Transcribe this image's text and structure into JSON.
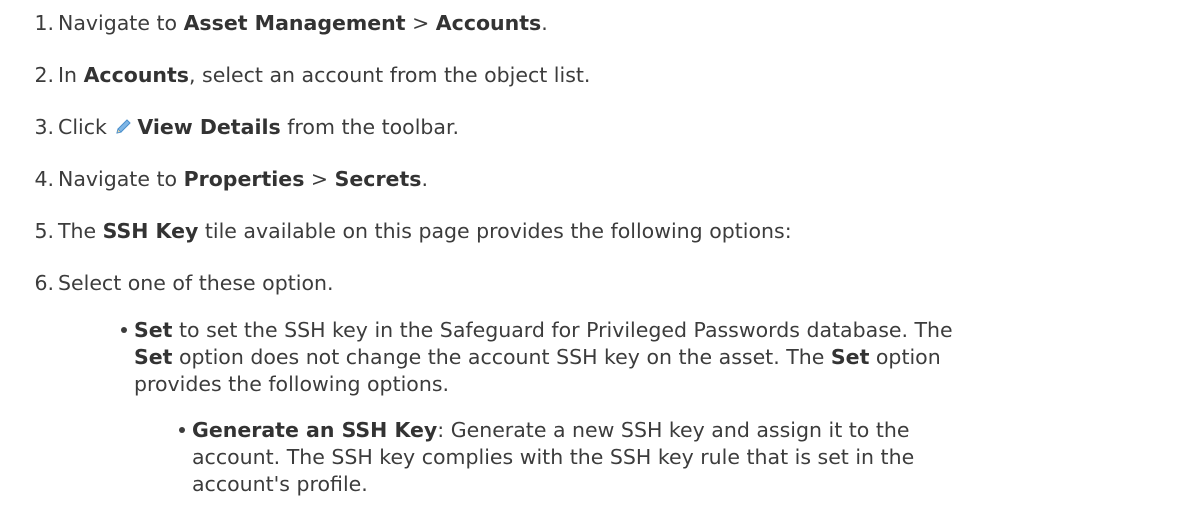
{
  "steps": [
    {
      "num": "1.",
      "a": "Navigate to ",
      "b1": "Asset Management",
      "c": " > ",
      "b2": "Accounts",
      "d": "."
    },
    {
      "num": "2.",
      "a": "In ",
      "b1": "Accounts",
      "c": ", select an account from the object list."
    },
    {
      "num": "3.",
      "a": "Click ",
      "icon": "pencil-icon",
      "b1": "View Details",
      "c": " from the toolbar."
    },
    {
      "num": "4.",
      "a": "Navigate to ",
      "b1": "Properties",
      "c": " > ",
      "b2": "Secrets",
      "d": "."
    },
    {
      "num": "5.",
      "a": "The ",
      "b1": "SSH Key",
      "c": " tile available on this page provides the following options:"
    },
    {
      "num": "6.",
      "a": "Select one of these option."
    }
  ],
  "bullet1": {
    "line1_b": "Set",
    "line1_t": " to set the SSH key in the Safeguard for Privileged Passwords database. The",
    "line2_b": "Set",
    "line2_t": " option does not change the account SSH key on the asset. The ",
    "line2_b2": "Set",
    "line2_t2": " option",
    "line3_t": "provides the following options."
  },
  "bullet2": {
    "line1_b": "Generate an SSH Key",
    "line1_t": ": Generate a new SSH key and assign it to the",
    "line2_t": "account. The SSH key complies with the SSH key rule that is set in the",
    "line3_t": "account's profile."
  },
  "colors": {
    "text": "#3c3c3c",
    "pencil": "#5aa0dc"
  }
}
